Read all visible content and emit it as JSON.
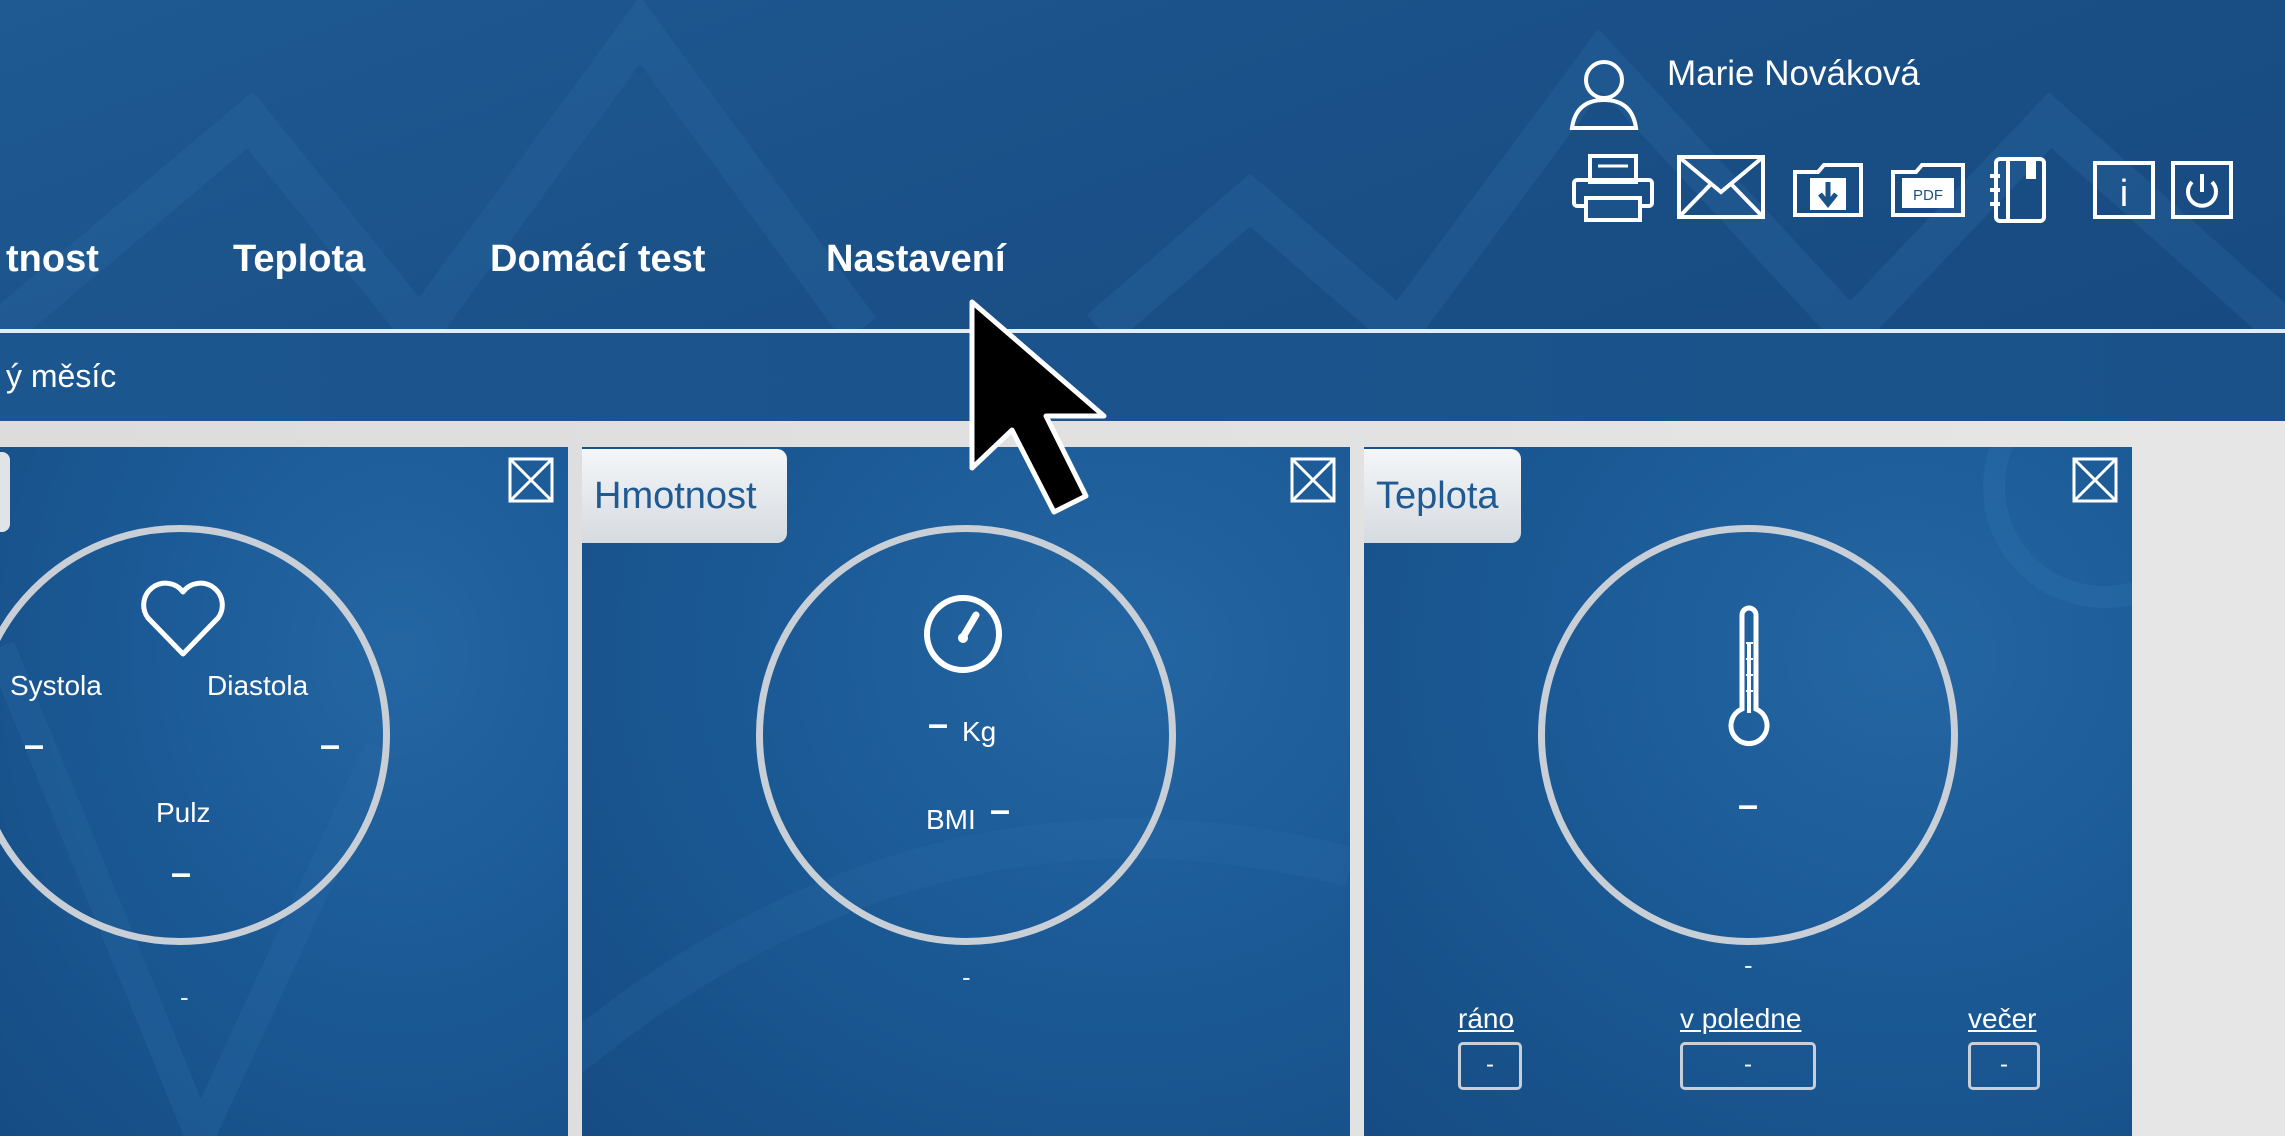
{
  "user": {
    "name": "Marie Nováková",
    "icon": "user-icon"
  },
  "toolbar": [
    {
      "id": "print",
      "icon": "printer-icon"
    },
    {
      "id": "email",
      "icon": "envelope-icon"
    },
    {
      "id": "download",
      "icon": "download-icon"
    },
    {
      "id": "pdf",
      "icon": "pdf-icon",
      "label": "PDF"
    },
    {
      "id": "notebook",
      "icon": "notebook-icon"
    },
    {
      "id": "info",
      "icon": "info-icon",
      "label": "i"
    },
    {
      "id": "power",
      "icon": "power-icon"
    }
  ],
  "nav": {
    "items": [
      "tnost",
      "Teplota",
      "Domácí test",
      "Nastavení"
    ]
  },
  "period": "ý měsíc",
  "panels": {
    "pressure": {
      "systola_label": "Systola",
      "systola_value": "–",
      "diastola_label": "Diastola",
      "diastola_value": "–",
      "pulz_label": "Pulz",
      "pulz_value": "–",
      "footer": "-"
    },
    "weight": {
      "title": "Hmotnost",
      "kg_value": "–",
      "kg_unit": "Kg",
      "bmi_label": "BMI",
      "bmi_value": "–",
      "footer": "-"
    },
    "temperature": {
      "title": "Teplota",
      "value": "–",
      "footer": "-",
      "times": [
        {
          "label": "ráno",
          "value": "-"
        },
        {
          "label": "v poledne",
          "value": "-"
        },
        {
          "label": "večer",
          "value": "-"
        }
      ]
    }
  },
  "colors": {
    "header": "#1b5289",
    "accent": "#1f5a93",
    "panel": "#1b5a96",
    "ring": "#c9cfd6"
  }
}
